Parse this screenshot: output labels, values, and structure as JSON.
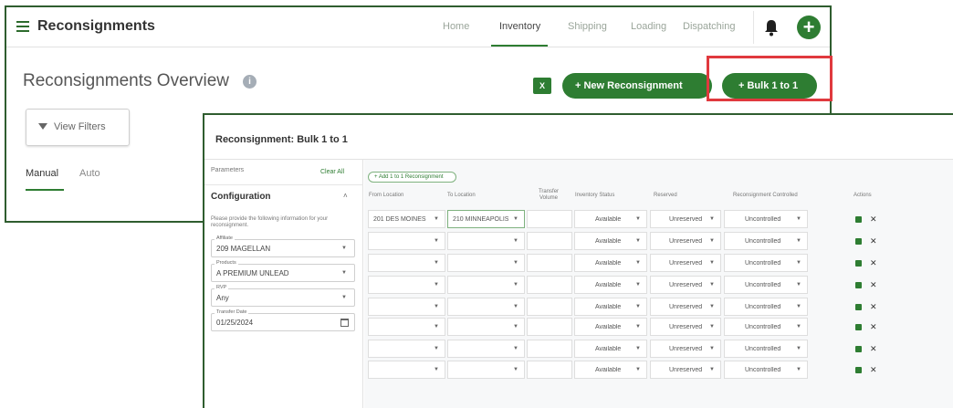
{
  "app": {
    "title": "Reconsignments",
    "nav": [
      "Home",
      "Inventory",
      "Shipping",
      "Loading",
      "Dispatching"
    ],
    "active_nav": "Inventory"
  },
  "overview": {
    "title": "Reconsignments Overview",
    "info_glyph": "i",
    "excel_glyph": "X",
    "new_button": "+ New Reconsignment",
    "bulk_button": "+ Bulk 1 to 1",
    "filters_button": "View Filters",
    "tabs": [
      "Manual",
      "Auto"
    ],
    "active_tab": "Manual"
  },
  "dialog": {
    "title": "Reconsignment: Bulk 1 to 1",
    "parameters_label": "Parameters",
    "clear_all": "Clear All",
    "configuration_title": "Configuration",
    "configuration_desc": "Please provide the following information for your reconsignment.",
    "fields": [
      {
        "label": "Affiliate",
        "value": "209 MAGELLAN",
        "kind": "select"
      },
      {
        "label": "Products",
        "value": "A PREMIUM UNLEAD",
        "kind": "select"
      },
      {
        "label": "RVP",
        "value": "Any",
        "kind": "select"
      },
      {
        "label": "Transfer Date",
        "value": "01/25/2024",
        "kind": "date"
      }
    ],
    "add_button": "+ Add 1 to 1 Reconsignment",
    "columns": [
      "From Location",
      "To Location",
      "Transfer Volume",
      "Inventory Status",
      "Reserved",
      "Reconsignment Controlled",
      "Actions"
    ],
    "rows": [
      {
        "from": "201 DES MOINES",
        "to": "210 MINNEAPOLIS",
        "volume": "",
        "status": "Available",
        "reserved": "Unreserved",
        "controlled": "Uncontrolled"
      },
      {
        "from": "",
        "to": "",
        "volume": "",
        "status": "Available",
        "reserved": "Unreserved",
        "controlled": "Uncontrolled"
      },
      {
        "from": "",
        "to": "",
        "volume": "",
        "status": "Available",
        "reserved": "Unreserved",
        "controlled": "Uncontrolled"
      },
      {
        "from": "",
        "to": "",
        "volume": "",
        "status": "Available",
        "reserved": "Unreserved",
        "controlled": "Uncontrolled"
      },
      {
        "from": "",
        "to": "",
        "volume": "",
        "status": "Available",
        "reserved": "Unreserved",
        "controlled": "Uncontrolled"
      },
      {
        "from": "",
        "to": "",
        "volume": "",
        "status": "Available",
        "reserved": "Unreserved",
        "controlled": "Uncontrolled"
      },
      {
        "from": "",
        "to": "",
        "volume": "",
        "status": "Available",
        "reserved": "Unreserved",
        "controlled": "Uncontrolled"
      },
      {
        "from": "",
        "to": "",
        "volume": "",
        "status": "Available",
        "reserved": "Unreserved",
        "controlled": "Uncontrolled"
      }
    ],
    "remove_glyph": "✕"
  },
  "colors": {
    "accent": "#2e7d32",
    "highlight": "#e0393e",
    "window_border": "#2f5d2f"
  }
}
